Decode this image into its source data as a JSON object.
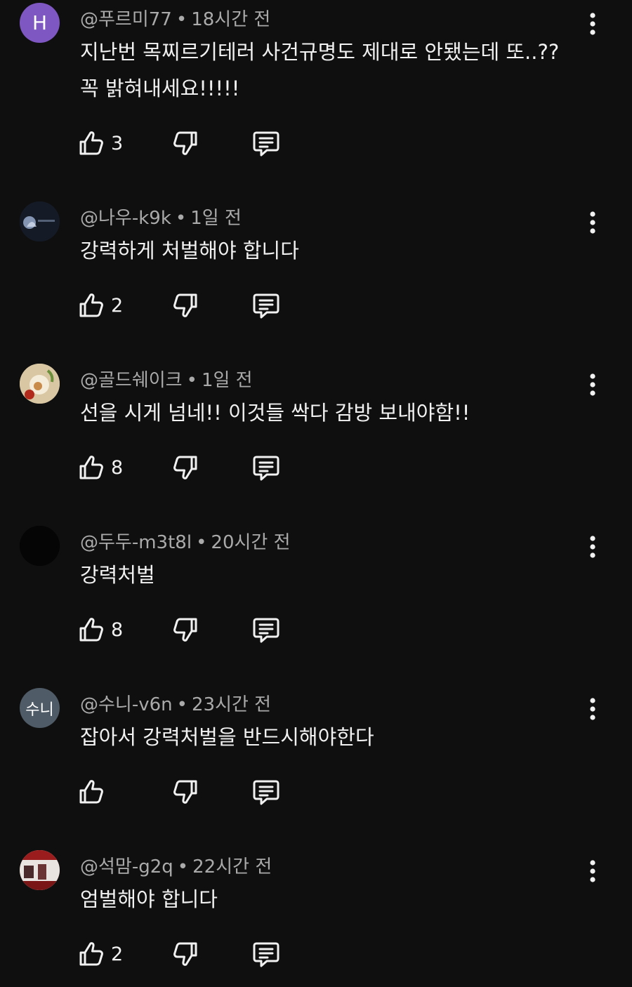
{
  "comments": [
    {
      "handle": "@푸르미77",
      "time": "18시간 전",
      "lines": [
        "지난번 목찌르기테러 사건규명도 제대로 안됐는데 또..??",
        "꼭 밝혀내세요!!!!!"
      ],
      "likes": "3",
      "avatar": {
        "type": "letter",
        "text": "H",
        "color": "#7e57c2"
      }
    },
    {
      "handle": "@나우-k9k",
      "time": "1일 전",
      "lines": [
        "강력하게 처벌해야 합니다"
      ],
      "likes": "2",
      "avatar": {
        "type": "image",
        "text": "",
        "color": "#1b2230"
      }
    },
    {
      "handle": "@골드쉐이크",
      "time": "1일 전",
      "lines": [
        "선을 시게 넘네!! 이것들 싹다 감방 보내야함!!"
      ],
      "likes": "8",
      "avatar": {
        "type": "image",
        "text": "",
        "color": "#c9b48f"
      }
    },
    {
      "handle": "@두두-m3t8l",
      "time": "20시간 전",
      "lines": [
        "강력처벌"
      ],
      "likes": "8",
      "avatar": {
        "type": "image",
        "text": "",
        "color": "#000000"
      }
    },
    {
      "handle": "@수니-v6n",
      "time": "23시간 전",
      "lines": [
        "잡아서 강력처벌을 반드시해야한다"
      ],
      "likes": "",
      "avatar": {
        "type": "text",
        "text": "수니",
        "color": "#4f5b66"
      }
    },
    {
      "handle": "@석맘-g2q",
      "time": "22시간 전",
      "lines": [
        "엄벌해야 합니다"
      ],
      "likes": "2",
      "avatar": {
        "type": "image",
        "text": "",
        "color": "#8b1e1e"
      }
    }
  ],
  "icons": {
    "like": "thumb-up-outline",
    "dislike": "thumb-down-outline",
    "reply": "comment-outline",
    "more": "vertical-ellipsis"
  },
  "colors": {
    "background": "#0f0f0f",
    "text_primary": "#f1f1f1",
    "text_secondary": "#aaaaaa"
  }
}
